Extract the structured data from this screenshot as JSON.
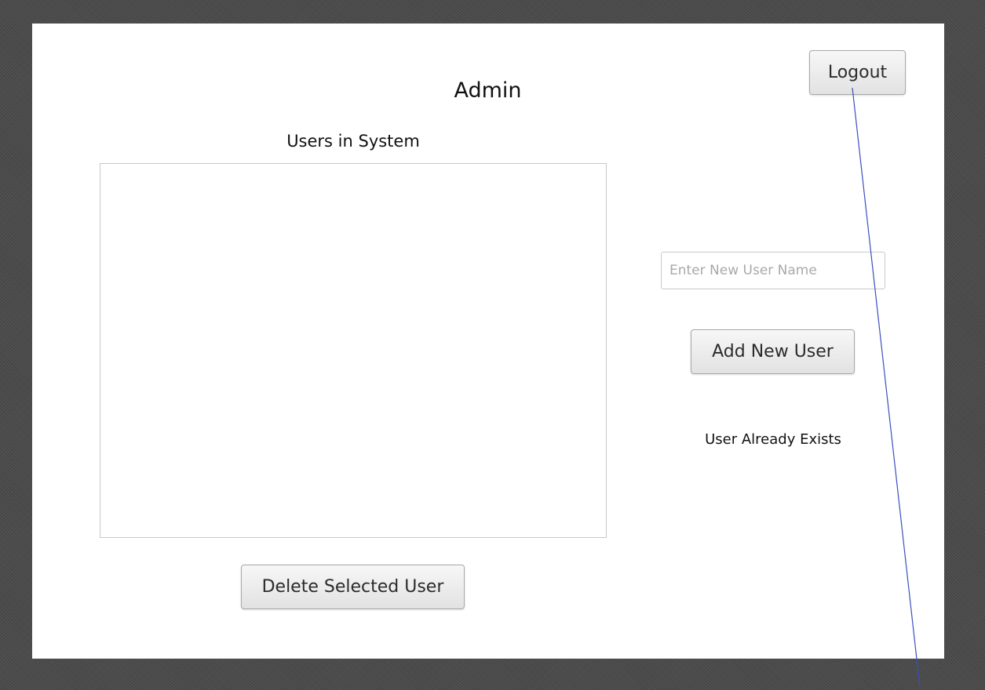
{
  "window": {
    "title": "Admin"
  },
  "header": {
    "logout_label": "Logout"
  },
  "users": {
    "label": "Users in System",
    "items": []
  },
  "new_user": {
    "placeholder": "Enter New User Name",
    "value": "",
    "add_label": "Add New User",
    "status_message": "User Already Exists"
  },
  "actions": {
    "delete_label": "Delete Selected User"
  },
  "colors": {
    "backdrop": "#4b4b4b",
    "window": "#ffffff",
    "annotation_line": "#3a4fbf"
  }
}
